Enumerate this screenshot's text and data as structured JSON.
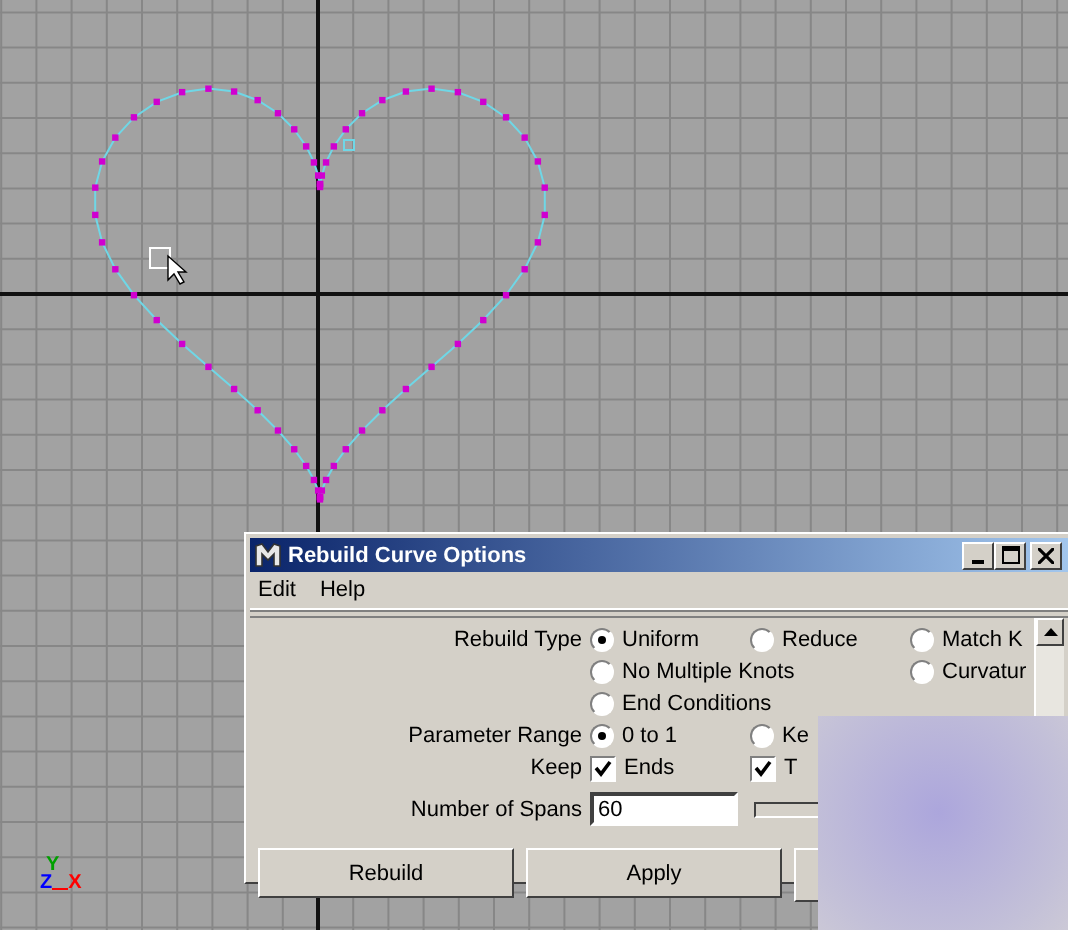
{
  "viewport": {
    "axis_labels": [
      {
        "text": "Y",
        "color": "#00a000"
      },
      {
        "text": "Z",
        "color": "#0000ff"
      },
      {
        "text": "X",
        "color": "#ff0000"
      }
    ]
  },
  "dialog": {
    "title": "Rebuild Curve Options",
    "menu": [
      "Edit",
      "Help"
    ],
    "rows": [
      {
        "label": "Rebuild Type",
        "kind": "radio",
        "col1": {
          "text": "Uniform",
          "selected": true
        },
        "col2": {
          "text": "Reduce",
          "selected": false
        },
        "col3": {
          "text": "Match K",
          "selected": false
        }
      },
      {
        "kind": "radio",
        "col1": {
          "text": "No Multiple Knots",
          "selected": false
        },
        "col3": {
          "text": "Curvatur",
          "selected": false
        }
      },
      {
        "kind": "radio",
        "col1": {
          "text": "End Conditions",
          "selected": false
        }
      },
      {
        "label": "Parameter Range",
        "kind": "radio",
        "col1": {
          "text": "0 to 1",
          "selected": true
        },
        "col2": {
          "text": "Ke",
          "selected": false
        }
      },
      {
        "label": "Keep",
        "kind": "checkbox",
        "col1": {
          "text": "Ends",
          "checked": true
        },
        "col2": {
          "text": "T",
          "checked": true
        }
      },
      {
        "label": "Number of Spans",
        "kind": "field",
        "value": "60"
      }
    ],
    "buttons": [
      {
        "label": "Rebuild"
      },
      {
        "label": "Apply"
      }
    ]
  }
}
